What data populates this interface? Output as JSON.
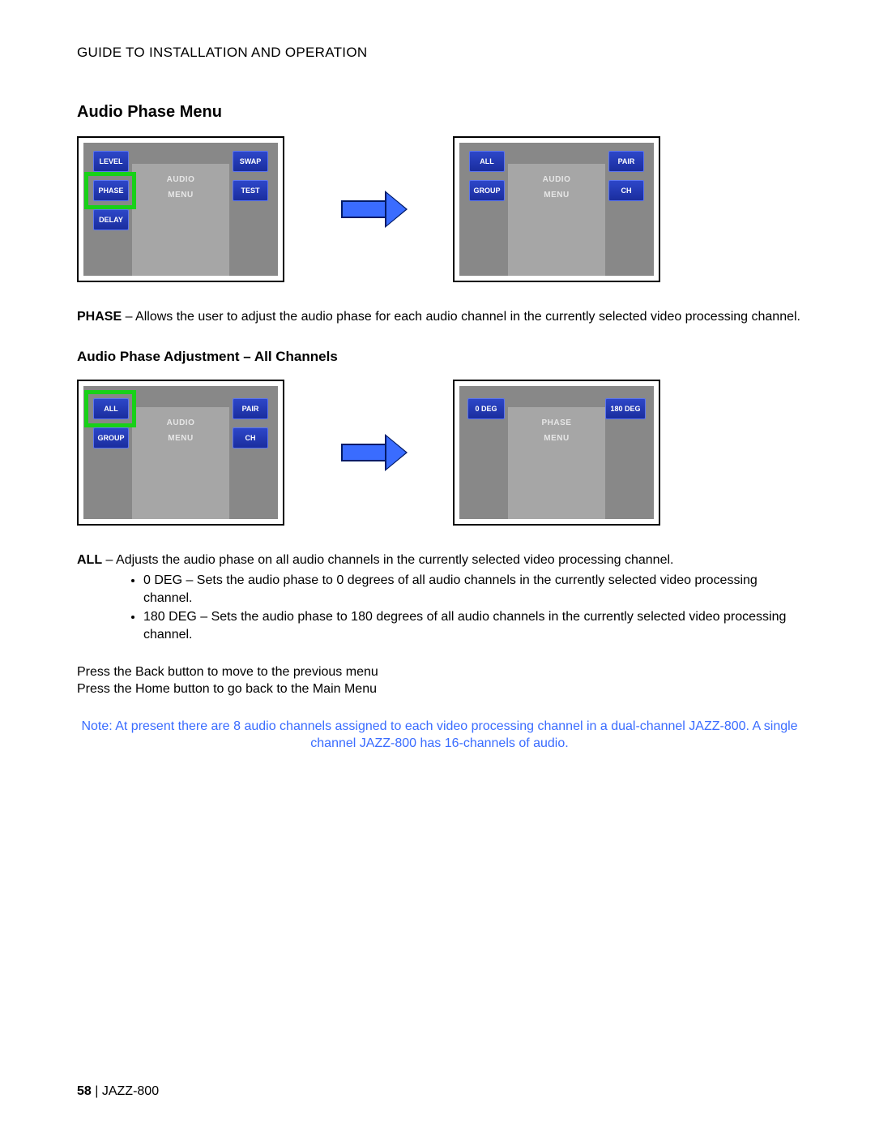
{
  "header": "GUIDE TO INSTALLATION AND OPERATION",
  "section_title": "Audio Phase Menu",
  "row1": {
    "left": {
      "menu_top": "AUDIO",
      "menu_sub": "MENU",
      "buttons": {
        "level": "LEVEL",
        "phase": "PHASE",
        "delay": "DELAY",
        "swap": "SWAP",
        "test": "TEST"
      }
    },
    "right": {
      "menu_top": "AUDIO",
      "menu_sub": "MENU",
      "buttons": {
        "all": "ALL",
        "group": "GROUP",
        "pair": "PAIR",
        "ch": "CH"
      }
    }
  },
  "phase_para_lead": "PHASE",
  "phase_para_body": " – Allows the user to adjust the audio phase for each audio channel in the currently selected video processing channel.",
  "sub_title": "Audio Phase Adjustment – All Channels",
  "row2": {
    "left": {
      "menu_top": "AUDIO",
      "menu_sub": "MENU",
      "buttons": {
        "all": "ALL",
        "group": "GROUP",
        "pair": "PAIR",
        "ch": "CH"
      }
    },
    "right": {
      "menu_top": "PHASE",
      "menu_sub": "MENU",
      "buttons": {
        "deg0": "0 DEG",
        "deg180": "180 DEG"
      }
    }
  },
  "all_para_lead": "ALL",
  "all_para_body": " – Adjusts the audio phase on all audio channels in the currently selected video processing channel.",
  "bullets": {
    "b1": "0 DEG – Sets the audio phase to 0 degrees of all audio channels in the currently selected video processing channel.",
    "b2": "180 DEG – Sets the audio phase to 180 degrees of all audio channels in the currently selected video processing channel."
  },
  "nav": {
    "line1": "Press the Back button to move to the previous menu",
    "line2": "Press the Home button to go back to the Main Menu"
  },
  "note": "Note: At present there are 8 audio channels assigned to each video processing channel in a dual-channel JAZZ-800. A single channel JAZZ-800 has 16-channels of audio.",
  "footer": {
    "page": "58",
    "sep": "  |  ",
    "product": "JAZZ-800"
  }
}
